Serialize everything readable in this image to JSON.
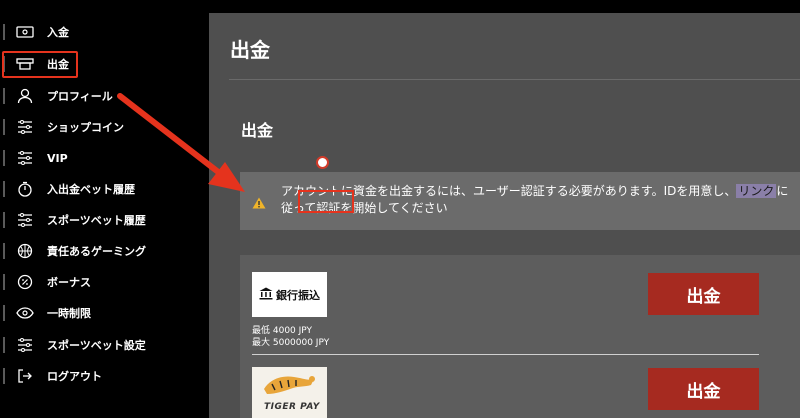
{
  "sidebar": {
    "items": [
      {
        "label": "入金",
        "icon": "cash-icon"
      },
      {
        "label": "出金",
        "icon": "withdraw-icon"
      },
      {
        "label": "プロフィール",
        "icon": "user-icon"
      },
      {
        "label": "ショップコイン",
        "icon": "sliders-icon"
      },
      {
        "label": "VIP",
        "icon": "sliders-icon"
      },
      {
        "label": "入出金ベット履歴",
        "icon": "timer-icon"
      },
      {
        "label": "スポーツベット履歴",
        "icon": "sliders-icon"
      },
      {
        "label": "責任あるゲーミング",
        "icon": "basketball-icon"
      },
      {
        "label": "ボーナス",
        "icon": "percent-icon"
      },
      {
        "label": "一時制限",
        "icon": "eye-icon"
      },
      {
        "label": "スポーツベット設定",
        "icon": "sliders-icon"
      },
      {
        "label": "ログアウト",
        "icon": "logout-icon"
      }
    ]
  },
  "main": {
    "title": "出金",
    "section_title": "出金",
    "notice": {
      "text_before": "アカウントに資金を出金するには、ユーザー認証する必要があります。IDを用意し、",
      "link": "リンク",
      "text_after": "に従って認証を開始してください"
    },
    "methods": [
      {
        "logo_text": "銀行振込",
        "min": "最低 4000 JPY",
        "max": "最大 5000000 JPY",
        "button": "出金"
      },
      {
        "logo_text": "TIGER PAY",
        "button": "出金"
      }
    ]
  },
  "colors": {
    "highlight": "#e5331d",
    "button": "#a62a20",
    "panel": "#4f4f4f"
  }
}
